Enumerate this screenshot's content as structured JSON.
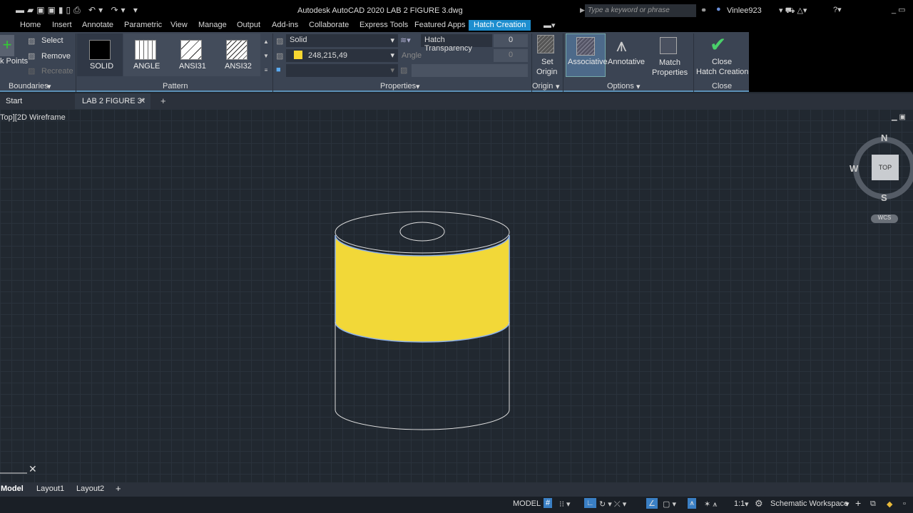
{
  "title": "Autodesk AutoCAD 2020   LAB 2 FIGURE 3.dwg",
  "search_placeholder": "Type a keyword or phrase",
  "user": "Vinlee923",
  "tabs": [
    "Home",
    "Insert",
    "Annotate",
    "Parametric",
    "View",
    "Manage",
    "Output",
    "Add-ins",
    "Collaborate",
    "Express Tools",
    "Featured Apps",
    "Hatch Creation"
  ],
  "boundaries": {
    "pick": "k Points",
    "select": "Select",
    "remove": "Remove",
    "recreate": "Recreate",
    "title": "Boundaries"
  },
  "pattern": {
    "items": [
      "SOLID",
      "ANGLE",
      "ANSI31",
      "ANSI32"
    ],
    "title": "Pattern"
  },
  "properties": {
    "type": "Solid",
    "color": "248,215,49",
    "color_hex": "#f8d731",
    "transparency_label": "Hatch Transparency",
    "transparency": "0",
    "angle_label": "Angle",
    "angle": "0",
    "title": "Properties"
  },
  "origin": {
    "set": "Set",
    "set2": "Origin",
    "title": "Origin"
  },
  "options": {
    "associative": "Associative",
    "annotative": "Annotative",
    "match1": "Match",
    "match2": "Properties",
    "title": "Options"
  },
  "close": {
    "l1": "Close",
    "l2": "Hatch Creation",
    "title": "Close"
  },
  "doc_tabs": [
    "Start",
    "LAB 2 FIGURE 3*"
  ],
  "viewport_label": "Top][2D Wireframe",
  "viewcube": {
    "n": "N",
    "s": "S",
    "w": "W",
    "face": "TOP",
    "wcs": "WCS"
  },
  "layouts": [
    "Model",
    "Layout1",
    "Layout2"
  ],
  "status": {
    "model": "MODEL",
    "scale": "1:1",
    "workspace": "Schematic Workspace"
  }
}
